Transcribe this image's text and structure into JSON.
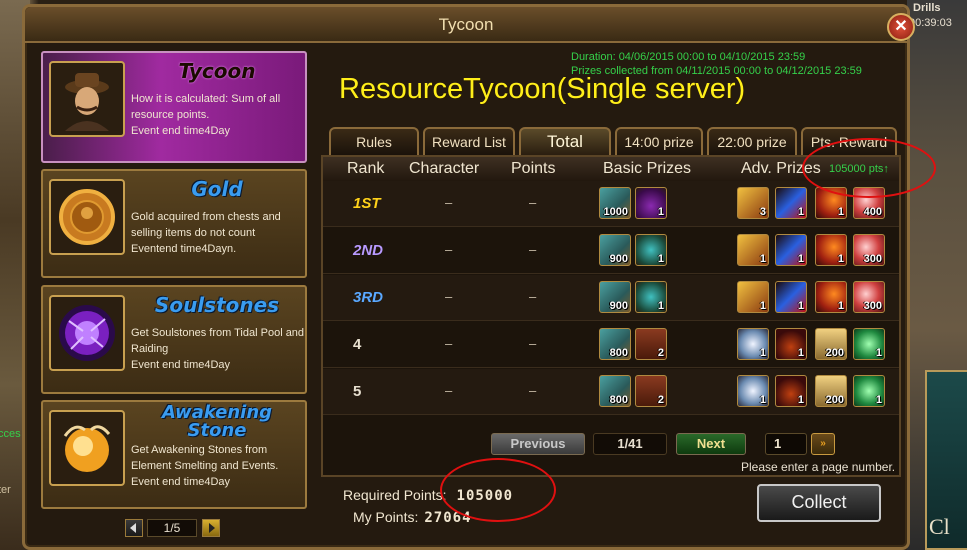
{
  "window": {
    "title": "Tycoon"
  },
  "background": {
    "left_text_1": "cces",
    "left_text_2": "ter",
    "right_label": "Drills",
    "right_clock": "00:39:03",
    "right_card_text": "Cl"
  },
  "sidebar": {
    "cards": [
      {
        "name": "Tycoon",
        "desc": "How it is calculated: Sum of all resource points.",
        "event": "Event end time4Day",
        "icon": "merchant-portrait"
      },
      {
        "name": "Gold",
        "desc": "Gold acquired from chests and selling items do not count",
        "event": "Eventend time4Dayn.",
        "icon": "gold-coin"
      },
      {
        "name": "Soulstones",
        "desc": "Get Soulstones from Tidal Pool and Raiding",
        "event": "Event end time4Day",
        "icon": "soulstone-orb"
      },
      {
        "name": "Awakening Stone",
        "desc": "Get Awakening Stones from Element Smelting and Events.",
        "event": "Event end time4Day",
        "icon": "awakening-stone"
      }
    ],
    "pager": {
      "label": "1/5"
    }
  },
  "main": {
    "duration": "Duration: 04/06/2015 00:00 to 04/10/2015 23:59",
    "prizes": "Prizes collected from 04/11/2015 00:00 to 04/12/2015 23:59",
    "headline": "ResourceTycoon(Single server)",
    "tabs": [
      "Rules",
      "Reward List",
      "Total",
      "14:00 prize",
      "22:00 prize",
      "Pts. Reward"
    ],
    "active_tab": "Total",
    "columns": [
      "Rank",
      "Character",
      "Points",
      "Basic Prizes",
      "Adv. Prizes"
    ],
    "pts_info": "105000 pts↑",
    "rows": [
      {
        "rank": "1ST",
        "char": "–",
        "points": "–",
        "basic": [
          {
            "icon": "skill-book",
            "count": "1000"
          },
          {
            "icon": "purple-potion",
            "count": "1"
          }
        ],
        "adv": [
          {
            "icon": "golden-helm",
            "count": "3"
          },
          {
            "icon": "blue-sword",
            "count": "1"
          },
          {
            "icon": "flame-gauntlet",
            "count": "1"
          },
          {
            "icon": "red-orb",
            "count": "400"
          }
        ]
      },
      {
        "rank": "2ND",
        "char": "–",
        "points": "–",
        "basic": [
          {
            "icon": "skill-book",
            "count": "900"
          },
          {
            "icon": "teal-armor",
            "count": "1"
          }
        ],
        "adv": [
          {
            "icon": "golden-helm",
            "count": "1"
          },
          {
            "icon": "blue-sword",
            "count": "1"
          },
          {
            "icon": "flame-gauntlet",
            "count": "1"
          },
          {
            "icon": "red-orb",
            "count": "300"
          }
        ]
      },
      {
        "rank": "3RD",
        "char": "–",
        "points": "–",
        "basic": [
          {
            "icon": "skill-book",
            "count": "900"
          },
          {
            "icon": "teal-armor",
            "count": "1"
          }
        ],
        "adv": [
          {
            "icon": "golden-helm",
            "count": "1"
          },
          {
            "icon": "blue-sword",
            "count": "1"
          },
          {
            "icon": "flame-gauntlet",
            "count": "1"
          },
          {
            "icon": "red-orb",
            "count": "300"
          }
        ]
      },
      {
        "rank": "4",
        "char": "–",
        "points": "–",
        "basic": [
          {
            "icon": "skill-book",
            "count": "800"
          },
          {
            "icon": "treasure-chest",
            "count": "2"
          }
        ],
        "adv": [
          {
            "icon": "angel-wings",
            "count": "1"
          },
          {
            "icon": "flame-boot",
            "count": "1"
          },
          {
            "icon": "gold-scroll",
            "count": "200"
          },
          {
            "icon": "emerald-gem",
            "count": "1"
          }
        ]
      },
      {
        "rank": "5",
        "char": "–",
        "points": "–",
        "basic": [
          {
            "icon": "skill-book",
            "count": "800"
          },
          {
            "icon": "treasure-chest",
            "count": "2"
          }
        ],
        "adv": [
          {
            "icon": "angel-wings",
            "count": "1"
          },
          {
            "icon": "flame-boot",
            "count": "1"
          },
          {
            "icon": "gold-scroll",
            "count": "200"
          },
          {
            "icon": "emerald-gem",
            "count": "1"
          }
        ]
      }
    ],
    "rank_colors": [
      "#ffd21a",
      "#b89aff",
      "#5aa8ff",
      "#e8e0d0",
      "#e8e0d0"
    ],
    "pager": {
      "prev": "Previous",
      "page": "1/41",
      "next": "Next",
      "input_value": "1",
      "go": "»",
      "hint": "Please enter a page number."
    },
    "required_label": "Required Points:",
    "required_value": "105000",
    "my_label": "My Points:",
    "my_value": "27064",
    "collect": "Collect"
  }
}
